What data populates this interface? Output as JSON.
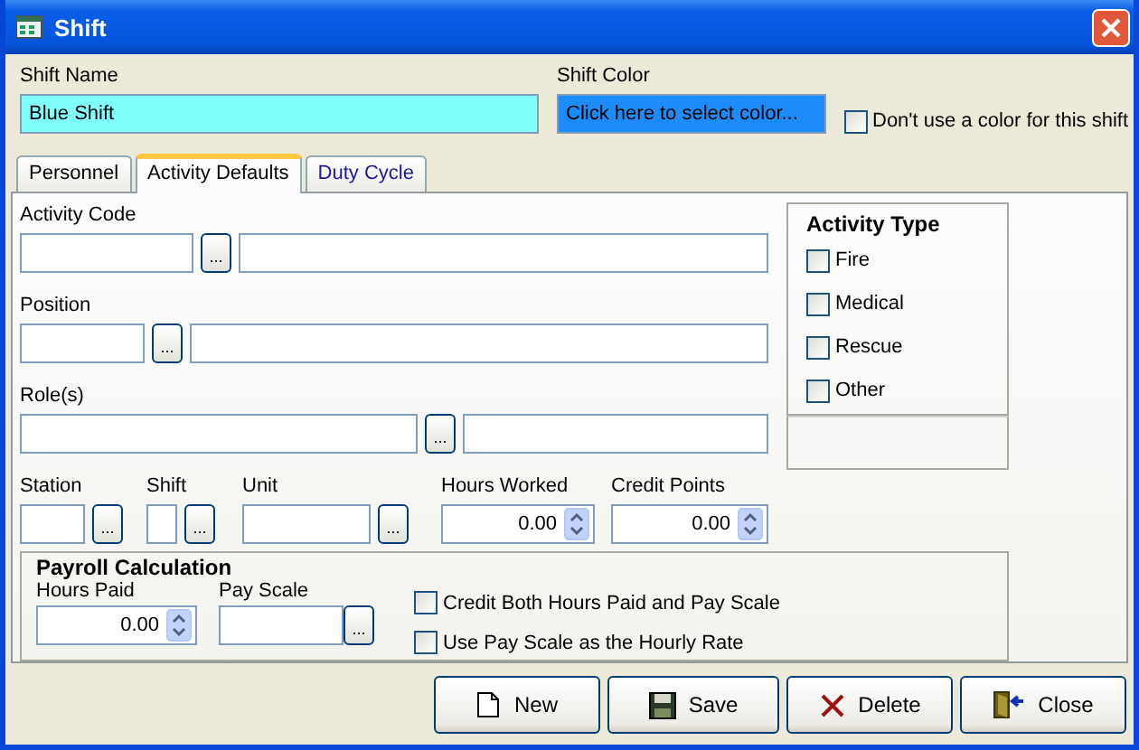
{
  "window": {
    "title": "Shift"
  },
  "shift_name": {
    "label": "Shift Name",
    "value": "Blue Shift"
  },
  "shift_color": {
    "label": "Shift Color",
    "value": "Click here to select color..."
  },
  "no_color": {
    "label": "Don't use a color for this shift",
    "checked": false
  },
  "tabs": [
    {
      "label": "Personnel",
      "selected": false
    },
    {
      "label": "Activity Defaults",
      "selected": true
    },
    {
      "label": "Duty Cycle",
      "selected": false
    }
  ],
  "activity_code": {
    "label": "Activity Code",
    "browse": "..."
  },
  "position": {
    "label": "Position",
    "browse": "..."
  },
  "roles": {
    "label": "Role(s)",
    "browse": "..."
  },
  "station": {
    "label": "Station",
    "browse": "..."
  },
  "shift": {
    "label": "Shift",
    "browse": "..."
  },
  "unit": {
    "label": "Unit",
    "browse": "..."
  },
  "hours_worked": {
    "label": "Hours Worked",
    "value": "0.00"
  },
  "credit_points": {
    "label": "Credit Points",
    "value": "0.00"
  },
  "activity_type": {
    "title": "Activity Type",
    "items": [
      {
        "label": "Fire",
        "checked": false
      },
      {
        "label": "Medical",
        "checked": false
      },
      {
        "label": "Rescue",
        "checked": false
      },
      {
        "label": "Other",
        "checked": false
      }
    ]
  },
  "payroll": {
    "title": "Payroll Calculation",
    "hours_paid": {
      "label": "Hours Paid",
      "value": "0.00"
    },
    "pay_scale": {
      "label": "Pay Scale",
      "browse": "..."
    },
    "options": [
      {
        "label": "Credit Both Hours Paid and Pay Scale",
        "checked": false
      },
      {
        "label": "Use Pay Scale as the Hourly Rate",
        "checked": false
      }
    ]
  },
  "buttons": [
    {
      "label": "New",
      "kind": "new"
    },
    {
      "label": "Save",
      "kind": "save"
    },
    {
      "label": "Delete",
      "kind": "delete"
    },
    {
      "label": "Close",
      "kind": "close"
    }
  ]
}
